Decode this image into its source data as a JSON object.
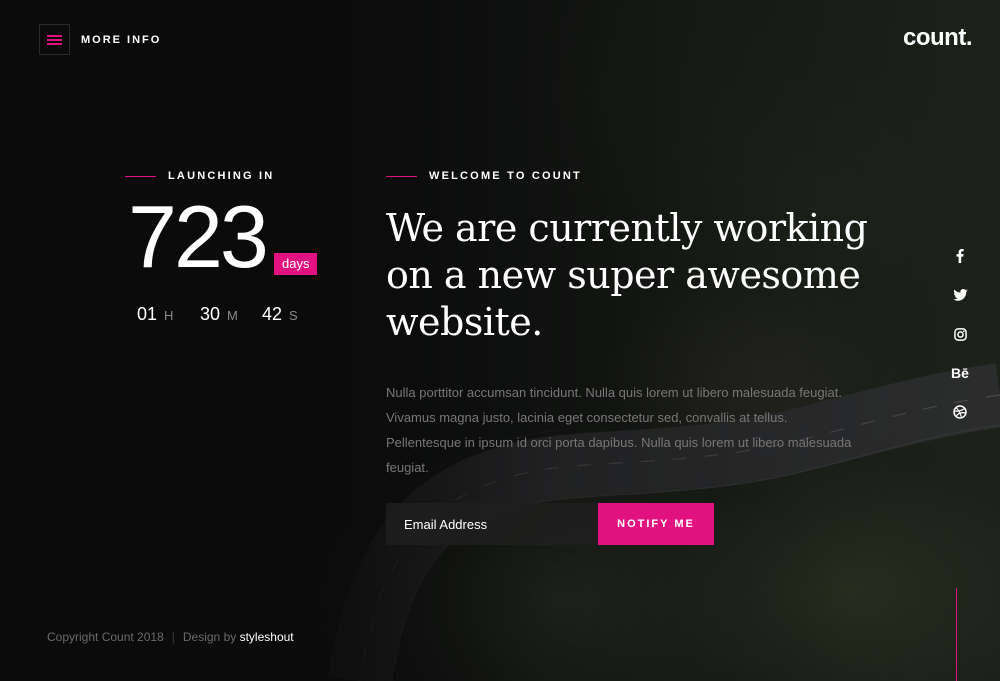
{
  "header": {
    "menu_label": "MORE INFO",
    "logo": "count."
  },
  "countdown": {
    "label": "LAUNCHING IN",
    "days": "723",
    "days_unit": "days",
    "hours": "01",
    "hours_unit": "H",
    "minutes": "30",
    "minutes_unit": "M",
    "seconds": "42",
    "seconds_unit": "S"
  },
  "intro": {
    "label": "WELCOME TO COUNT",
    "headline_line1": "We are currently working",
    "headline_line2": "on a new super awesome",
    "headline_line3": "website.",
    "description": "Nulla porttitor accumsan tincidunt. Nulla quis lorem ut libero malesuada feugiat. Vivamus magna justo, lacinia eget consectetur sed, convallis at tellus. Pellentesque in ipsum id orci porta dapibus. Nulla quis lorem ut libero malesuada feugiat."
  },
  "subscribe": {
    "email_placeholder": "Email Address",
    "button_label": "NOTIFY ME"
  },
  "social": {
    "items": [
      {
        "icon": "facebook-icon",
        "glyph": "f"
      },
      {
        "icon": "twitter-icon",
        "glyph": ""
      },
      {
        "icon": "instagram-icon",
        "glyph": ""
      },
      {
        "icon": "behance-icon",
        "glyph": "Bē"
      },
      {
        "icon": "dribbble-icon",
        "glyph": ""
      }
    ]
  },
  "footer": {
    "copyright": "Copyright Count 2018",
    "separator": "|",
    "design_by": "Design by",
    "brand": "styleshout"
  },
  "colors": {
    "accent": "#e1117f",
    "background": "#0b0b0c"
  }
}
